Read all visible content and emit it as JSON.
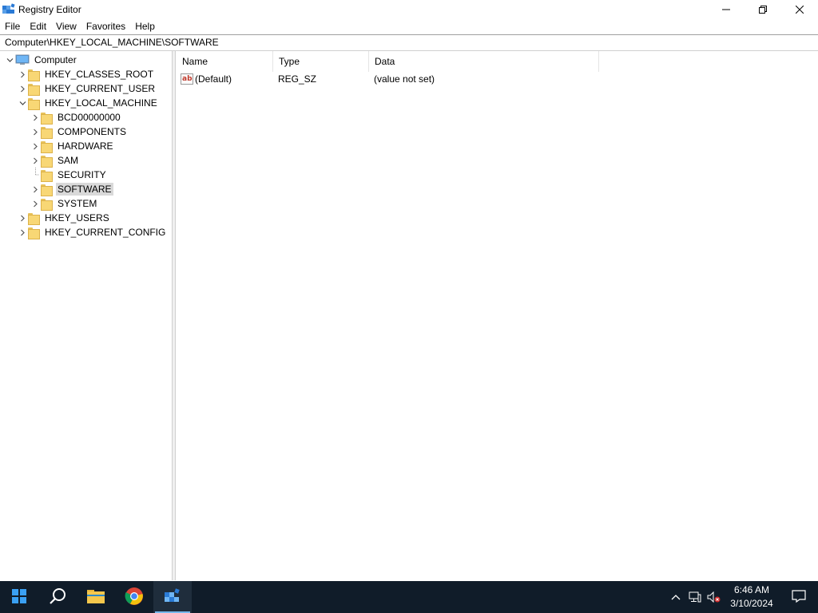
{
  "window": {
    "title": "Registry Editor",
    "controls": {
      "minimize": "—",
      "maximize": "❐",
      "close": "✕"
    }
  },
  "menu": [
    "File",
    "Edit",
    "View",
    "Favorites",
    "Help"
  ],
  "address": "Computer\\HKEY_LOCAL_MACHINE\\SOFTWARE",
  "tree": {
    "root": "Computer",
    "hives": [
      "HKEY_CLASSES_ROOT",
      "HKEY_CURRENT_USER",
      "HKEY_LOCAL_MACHINE",
      "HKEY_USERS",
      "HKEY_CURRENT_CONFIG"
    ],
    "hklm_children": [
      "BCD00000000",
      "COMPONENTS",
      "HARDWARE",
      "SAM",
      "SECURITY",
      "SOFTWARE",
      "SYSTEM"
    ],
    "selected": "SOFTWARE"
  },
  "list": {
    "columns": [
      "Name",
      "Type",
      "Data"
    ],
    "rows": [
      {
        "icon": "string-value-icon",
        "name": "(Default)",
        "type": "REG_SZ",
        "data": "(value not set)"
      }
    ]
  },
  "taskbar": {
    "buttons": [
      "start-icon",
      "search-icon",
      "file-explorer-icon",
      "chrome-icon",
      "registry-editor-icon"
    ],
    "active": "registry-editor-icon",
    "clock": {
      "time": "6:46 AM",
      "date": "3/10/2024"
    },
    "tray_icons": [
      "chevron-up-icon",
      "network-icon",
      "volume-muted-icon",
      "notification-icon"
    ]
  },
  "colors": {
    "taskbar": "#101c29",
    "selection": "#d9d9d9",
    "folder": "#f8d775",
    "accent": "#76b9ed"
  }
}
